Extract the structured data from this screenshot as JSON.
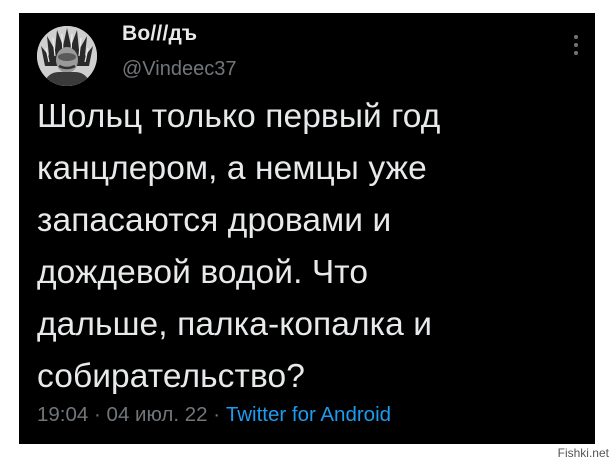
{
  "tweet": {
    "author": {
      "display_name": "Во///дъ",
      "handle": "@Vindeec37",
      "avatar_icon": "avatar-portrait-icon"
    },
    "text_lines": [
      "Шольц только первый год",
      "канцлером, а немцы уже",
      "запасаются дровами и",
      "дождевой водой. Что",
      "дальше, палка-копалка и",
      "собирательство?"
    ],
    "time": "19:04",
    "separator": "·",
    "date": "04 июл. 22",
    "source": "Twitter for Android"
  },
  "watermark": "Fishki.net",
  "colors": {
    "card_background": "#000000",
    "text_primary": "#e7e9ea",
    "text_secondary": "#71767b",
    "link": "#1d9bf0"
  }
}
